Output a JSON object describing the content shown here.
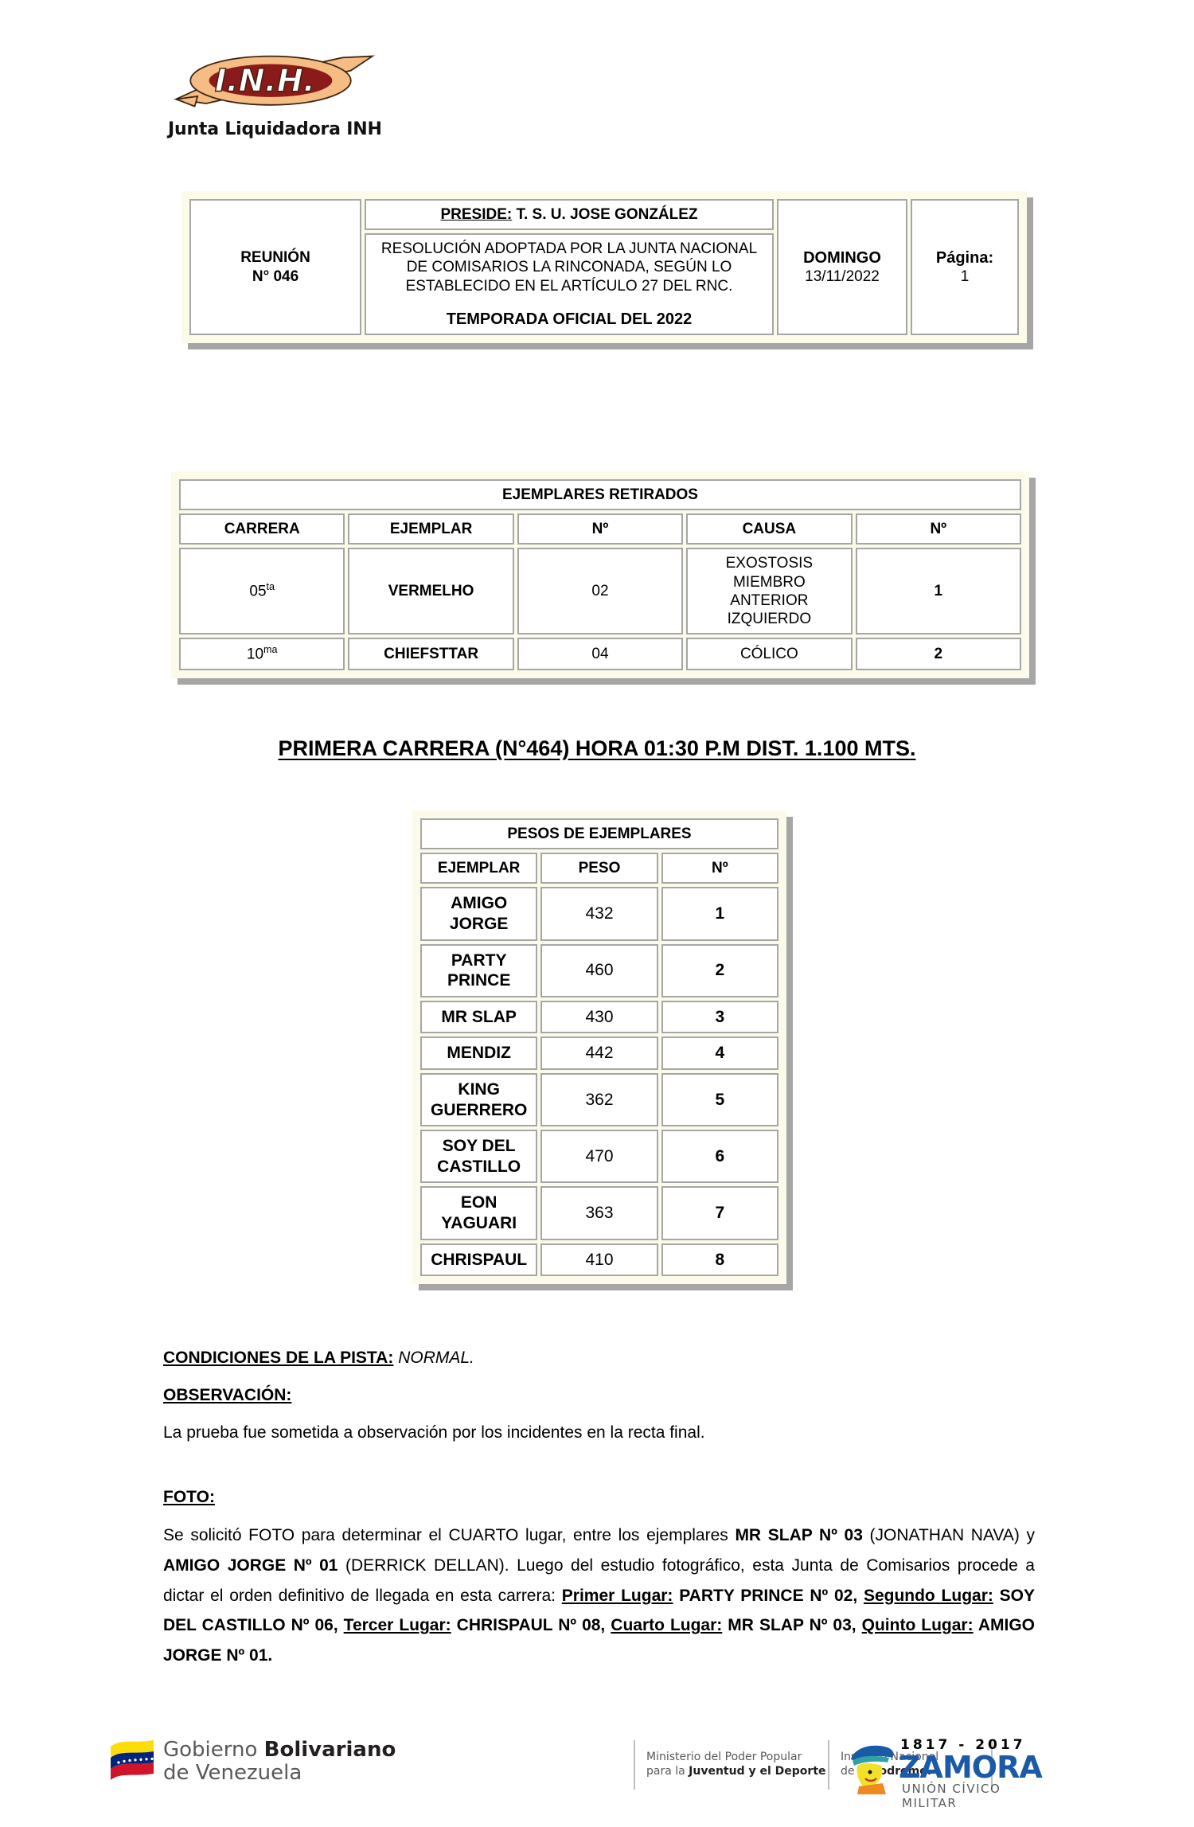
{
  "logo": {
    "brand": "I.N.H.",
    "caption": "Junta Liquidadora INH"
  },
  "header": {
    "reunion_label": "REUNIÓN",
    "reunion_number": "N° 046",
    "preside_label": "PRESIDE:",
    "preside_name": "T. S. U. JOSE GONZÁLEZ",
    "resolution_text": "RESOLUCIÓN ADOPTADA POR LA JUNTA NACIONAL DE COMISARIOS LA RINCONADA, SEGÚN LO ESTABLECIDO EN EL ARTÍCULO 27 DEL RNC.",
    "temporada": "TEMPORADA OFICIAL DEL 2022",
    "day_label": "DOMINGO",
    "date": "13/11/2022",
    "page_label": "Página:",
    "page_number": "1"
  },
  "retirados": {
    "title": "EJEMPLARES RETIRADOS",
    "columns": [
      "CARRERA",
      "EJEMPLAR",
      "Nº",
      "CAUSA",
      "Nº"
    ],
    "rows": [
      {
        "carrera": "05",
        "carrera_sup": "ta",
        "ejemplar": "VERMELHO",
        "numero": "02",
        "causa": "EXOSTOSIS MIEMBRO ANTERIOR IZQUIERDO",
        "orden": "1"
      },
      {
        "carrera": "10",
        "carrera_sup": "ma",
        "ejemplar": "CHIEFSTTAR",
        "numero": "04",
        "causa": "CÓLICO",
        "orden": "2"
      }
    ]
  },
  "race": {
    "title": "PRIMERA CARRERA (N°464) HORA 01:30 P.M DIST. 1.100 MTS."
  },
  "pesos": {
    "title": "PESOS DE EJEMPLARES",
    "columns": [
      "EJEMPLAR",
      "PESO",
      "Nº"
    ],
    "rows": [
      {
        "ejemplar": "AMIGO JORGE",
        "peso": "432",
        "numero": "1"
      },
      {
        "ejemplar": "PARTY PRINCE",
        "peso": "460",
        "numero": "2"
      },
      {
        "ejemplar": "MR SLAP",
        "peso": "430",
        "numero": "3"
      },
      {
        "ejemplar": "MENDIZ",
        "peso": "442",
        "numero": "4"
      },
      {
        "ejemplar": "KING GUERRERO",
        "peso": "362",
        "numero": "5"
      },
      {
        "ejemplar": "SOY DEL CASTILLO",
        "peso": "470",
        "numero": "6"
      },
      {
        "ejemplar": "EON YAGUARI",
        "peso": "363",
        "numero": "7"
      },
      {
        "ejemplar": "CHRISPAUL",
        "peso": "410",
        "numero": "8"
      }
    ]
  },
  "notes": {
    "pista_label": "CONDICIONES DE LA PISTA:",
    "pista_value": "NORMAL.",
    "observacion_label": "OBSERVACIÓN:",
    "observacion_text": "La prueba fue sometida a observación por los incidentes en la recta final.",
    "foto_label": "FOTO:",
    "foto_p1": "Se solicitó FOTO para determinar el CUARTO lugar, entre los ejemplares ",
    "foto_h1": "MR SLAP Nº 03",
    "foto_p2": " (JONATHAN NAVA) y ",
    "foto_h2": "AMIGO JORGE Nº 01",
    "foto_p3": " (DERRICK DELLAN). Luego del estudio fotográfico, esta Junta de Comisarios procede a dictar el orden definitivo de llegada en esta carrera: ",
    "place1_label": "Primer Lugar:",
    "place1_value": " PARTY PRINCE Nº 02, ",
    "place2_label": "Segundo Lugar:",
    "place2_value": " SOY DEL CASTILLO Nº 06, ",
    "place3_label": "Tercer Lugar:",
    "place3_value": " CHRISPAUL Nº 08, ",
    "place4_label": "Cuarto Lugar:",
    "place4_value": " MR SLAP Nº 03, ",
    "place5_label": "Quinto Lugar:",
    "place5_value": " AMIGO JORGE Nº 01."
  },
  "footer": {
    "gov_line1_light": "Gobierno ",
    "gov_line1_bold": "Bolivariano",
    "gov_line2": "de Venezuela",
    "ministry_line1": "Ministerio del Poder Popular",
    "ministry_line2_light": "para la ",
    "ministry_line2_bold": "Juventud y el Deporte",
    "institute_line1": "Instituto Nacional",
    "institute_line2_light": "de ",
    "institute_line2_bold": "Hipodromo.",
    "zamora_years": "1817 - 2017",
    "zamora_name": "ZAMORA",
    "zamora_sub": "UNIÓN CÍVICO MILITAR"
  },
  "colors": {
    "table_border": "#a6a6a6",
    "table_bg": "#fcfbe9",
    "accent_blue": "#1b5aa6",
    "logo_red": "#8b1a1a",
    "logo_tan": "#f5bd84"
  }
}
